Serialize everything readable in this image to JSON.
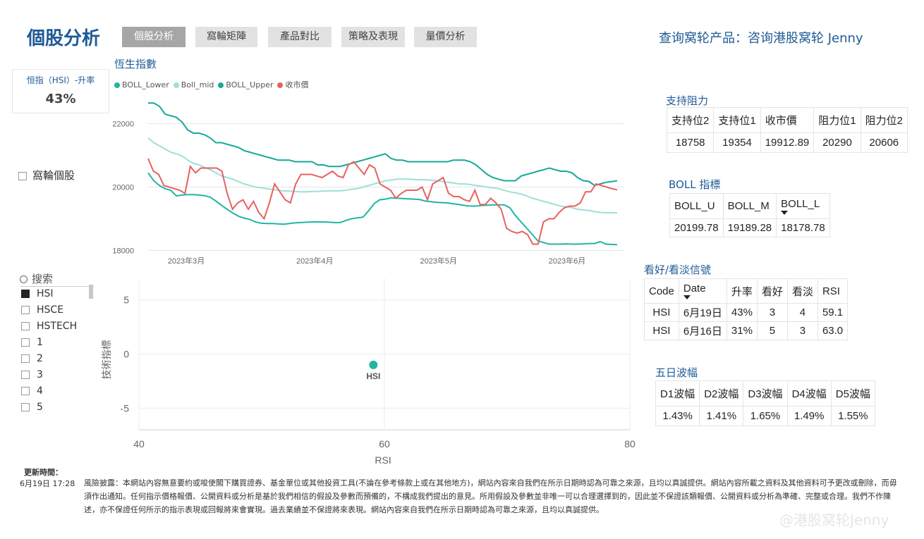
{
  "header": {
    "title": "個股分析",
    "tabs": [
      "個股分析",
      "窩輪矩陣",
      "產品對比",
      "策略及表現",
      "量價分析"
    ],
    "active_tab": 0,
    "query_text": "查询窝轮产品：咨询港股窝轮 Jenny"
  },
  "kpi": {
    "label": "恒指（HSI）-升率",
    "value": "43%"
  },
  "warrant_checkbox_label": "窩輪個股",
  "search": {
    "placeholder": "搜索"
  },
  "slicer": {
    "items": [
      "HSI",
      "HSCE",
      "HSTECH",
      "1",
      "2",
      "3",
      "4",
      "5"
    ],
    "selected": "HSI"
  },
  "support_resistance": {
    "title": "支持阻力",
    "headers": [
      "支持位2",
      "支持位1",
      "收市價",
      "阻力位1",
      "阻力位2"
    ],
    "values": [
      "18758",
      "19354",
      "19912.89",
      "20290",
      "20606"
    ]
  },
  "boll_indicator": {
    "title": "BOLL 指標",
    "headers": [
      "BOLL_U",
      "BOLL_M",
      "BOLL_L"
    ],
    "values": [
      "20199.78",
      "19189.28",
      "18178.78"
    ]
  },
  "signals": {
    "title": "看好/看淡信號",
    "headers": [
      "Code",
      "Date",
      "升率",
      "看好",
      "看淡",
      "RSI"
    ],
    "rows": [
      [
        "HSI",
        "6月19日",
        "43%",
        "3",
        "4",
        "59.1"
      ],
      [
        "HSI",
        "6月16日",
        "31%",
        "5",
        "3",
        "63.0"
      ]
    ]
  },
  "five_day": {
    "title": "五日波幅",
    "headers": [
      "D1波幅",
      "D2波幅",
      "D3波幅",
      "D4波幅",
      "D5波幅"
    ],
    "values": [
      "1.43%",
      "1.41%",
      "1.65%",
      "1.49%",
      "1.55%"
    ]
  },
  "footer": {
    "update_label": "更新時間：",
    "update_time": "6月19日 17:28",
    "disclaimer": "風險披露：本網站內容無意要約或唆使閣下購買證券、基金單位或其他投資工具(不論在參考條款上或在其他地方)，網站內容來自我們在所示日期時認為可靠之來源，且均以真誠提供。網站內容所載之資料及其他資料可予更改或刪除，而毋須作出通知。任何指示價格報價、公開資料或分析是基於我們相信的假設及參數而預備的，不構成我們提出的意見。所用假設及參數並非唯一可以合理選擇到的，因此並不保證該類報價、公開資料或分析為準確、完整或合理。我們不作陳述，亦不保證任何所示的指示表現或回報將來會實現。過去業績並不保證將來表現。網站內容來自我們在所示日期時認為可靠之來源，且均以真誠提供。",
    "watermark": "@港股窝轮Jenny"
  },
  "colors": {
    "boll_lower": "#21b5a6",
    "boll_mid": "#9fdfd8",
    "boll_upper": "#17a89a",
    "close": "#e8615e",
    "accent": "#1f5a96"
  },
  "chart_data": [
    {
      "type": "line",
      "title": "恆生指數",
      "ylim": [
        17900,
        22900
      ],
      "yticks": [
        18000,
        20000,
        22000
      ],
      "xticks": [
        "2023年3月",
        "2023年4月",
        "2023年5月",
        "2023年6月"
      ],
      "grid": true,
      "legend": "top-left",
      "series": [
        {
          "name": "BOLL_Lower",
          "values": [
            20450,
            20200,
            20050,
            19950,
            19900,
            19720,
            19750,
            19760,
            19760,
            19750,
            19730,
            19680,
            19560,
            19420,
            19300,
            19180,
            19080,
            19020,
            18980,
            18900,
            18860,
            18850,
            18850,
            18840,
            18830,
            18850,
            18870,
            18880,
            18890,
            18900,
            18900,
            18900,
            18890,
            18880,
            18880,
            18950,
            19000,
            19030,
            19050,
            19250,
            19480,
            19600,
            19620,
            19660,
            19650,
            19640,
            19630,
            19620,
            19610,
            19560,
            19540,
            19520,
            19510,
            19500,
            19470,
            19450,
            19420,
            19400,
            19400,
            19420,
            19430,
            19440,
            19440,
            19440,
            19350,
            19100,
            18900,
            18700,
            18500,
            18300,
            18250,
            18200,
            18200,
            18200,
            18210,
            18200,
            18200,
            18210,
            18220,
            18220,
            18280,
            18200,
            18190,
            18180
          ]
        },
        {
          "name": "Boll_mid",
          "values": [
            21550,
            21400,
            21300,
            21200,
            21100,
            21050,
            20980,
            20850,
            20750,
            20700,
            20620,
            20550,
            20450,
            20350,
            20300,
            20250,
            20170,
            20100,
            20050,
            20000,
            19980,
            19950,
            19920,
            19900,
            19880,
            19870,
            19860,
            19850,
            19850,
            19860,
            19860,
            19870,
            19880,
            19880,
            19880,
            19900,
            19930,
            19950,
            20000,
            20050,
            20100,
            20150,
            20200,
            20220,
            20250,
            20250,
            20250,
            20240,
            20230,
            20230,
            20220,
            20200,
            20180,
            20150,
            20130,
            20100,
            20100,
            20080,
            20050,
            20030,
            20000,
            19980,
            19950,
            19900,
            19850,
            19820,
            19780,
            19720,
            19650,
            19600,
            19550,
            19500,
            19450,
            19400,
            19380,
            19350,
            19300,
            19280,
            19260,
            19230,
            19200,
            19190,
            19190,
            19189
          ]
        },
        {
          "name": "BOLL_Upper",
          "values": [
            22650,
            22650,
            22550,
            22300,
            22250,
            22200,
            22050,
            21800,
            21700,
            21700,
            21650,
            21550,
            21400,
            21400,
            21350,
            21300,
            21250,
            21150,
            21100,
            21050,
            21000,
            20950,
            20900,
            20850,
            20850,
            20850,
            20800,
            20800,
            20800,
            20800,
            20700,
            20700,
            20650,
            20650,
            20650,
            20700,
            20750,
            20800,
            20850,
            20900,
            20950,
            21000,
            21050,
            20900,
            20850,
            20850,
            20800,
            20800,
            20800,
            20800,
            20800,
            20800,
            20800,
            20800,
            20850,
            20850,
            20850,
            20800,
            20700,
            20550,
            20400,
            20300,
            20250,
            20200,
            20200,
            20200,
            20350,
            20400,
            20450,
            20500,
            20550,
            20600,
            20550,
            20500,
            20500,
            20450,
            20300,
            20200,
            20180,
            20050,
            20100,
            20150,
            20170,
            20200
          ]
        },
        {
          "name": "收市價",
          "values": [
            20900,
            20500,
            20400,
            20050,
            20000,
            19950,
            19900,
            19800,
            20650,
            20450,
            20600,
            20600,
            20600,
            20600,
            20500,
            19800,
            19300,
            19500,
            19600,
            19300,
            19550,
            19200,
            19000,
            19500,
            20100,
            19850,
            19600,
            19500,
            20100,
            20400,
            20400,
            20400,
            20350,
            20300,
            20400,
            20500,
            20350,
            20300,
            20700,
            20800,
            20600,
            20400,
            20700,
            20600,
            20100,
            20000,
            19900,
            19650,
            19800,
            19900,
            19900,
            19900,
            20000,
            19600,
            20100,
            20200,
            20300,
            19800,
            19700,
            19700,
            19600,
            19550,
            19900,
            19450,
            19450,
            19650,
            19500,
            19300,
            18700,
            18600,
            18550,
            18600,
            18500,
            18200,
            18200,
            18900,
            19000,
            19000,
            19200,
            19350,
            19400,
            19400,
            19500,
            19850,
            19850,
            20100,
            20050,
            20000,
            19950,
            19913
          ]
        }
      ]
    },
    {
      "type": "scatter",
      "xlabel": "RSI",
      "ylabel": "技術指標",
      "xlim": [
        40,
        80
      ],
      "ylim": [
        -7,
        7
      ],
      "xticks": [
        40,
        60,
        80
      ],
      "yticks": [
        5,
        0,
        -5
      ],
      "points": [
        {
          "label": "HSI",
          "x": 59.1,
          "y": -1
        }
      ]
    }
  ]
}
